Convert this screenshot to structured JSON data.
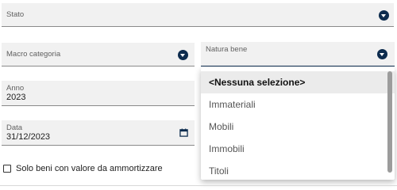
{
  "form": {
    "stato": {
      "label": "Stato",
      "value": ""
    },
    "macro_categoria": {
      "label": "Macro categoria",
      "value": ""
    },
    "natura_bene": {
      "label": "Natura bene",
      "value": ""
    },
    "anno": {
      "label": "Anno",
      "value": "2023"
    },
    "data": {
      "label": "Data",
      "value": "31/12/2023"
    },
    "solo_beni": {
      "label": "Solo beni con valore da ammortizzare",
      "checked": false
    }
  },
  "dropdown": {
    "options": [
      {
        "label": "<Nessuna selezione>",
        "selected": true
      },
      {
        "label": "Immateriali",
        "selected": false
      },
      {
        "label": "Mobili",
        "selected": false
      },
      {
        "label": "Immobili",
        "selected": false
      },
      {
        "label": "Titoli",
        "selected": false
      }
    ]
  },
  "icons": {
    "caret": "chevron-down-circle-icon",
    "calendar": "calendar-icon"
  },
  "colors": {
    "accent": "#0d2c4e",
    "field_bg": "#f1f1f1",
    "selected_bg": "#ebebeb"
  }
}
